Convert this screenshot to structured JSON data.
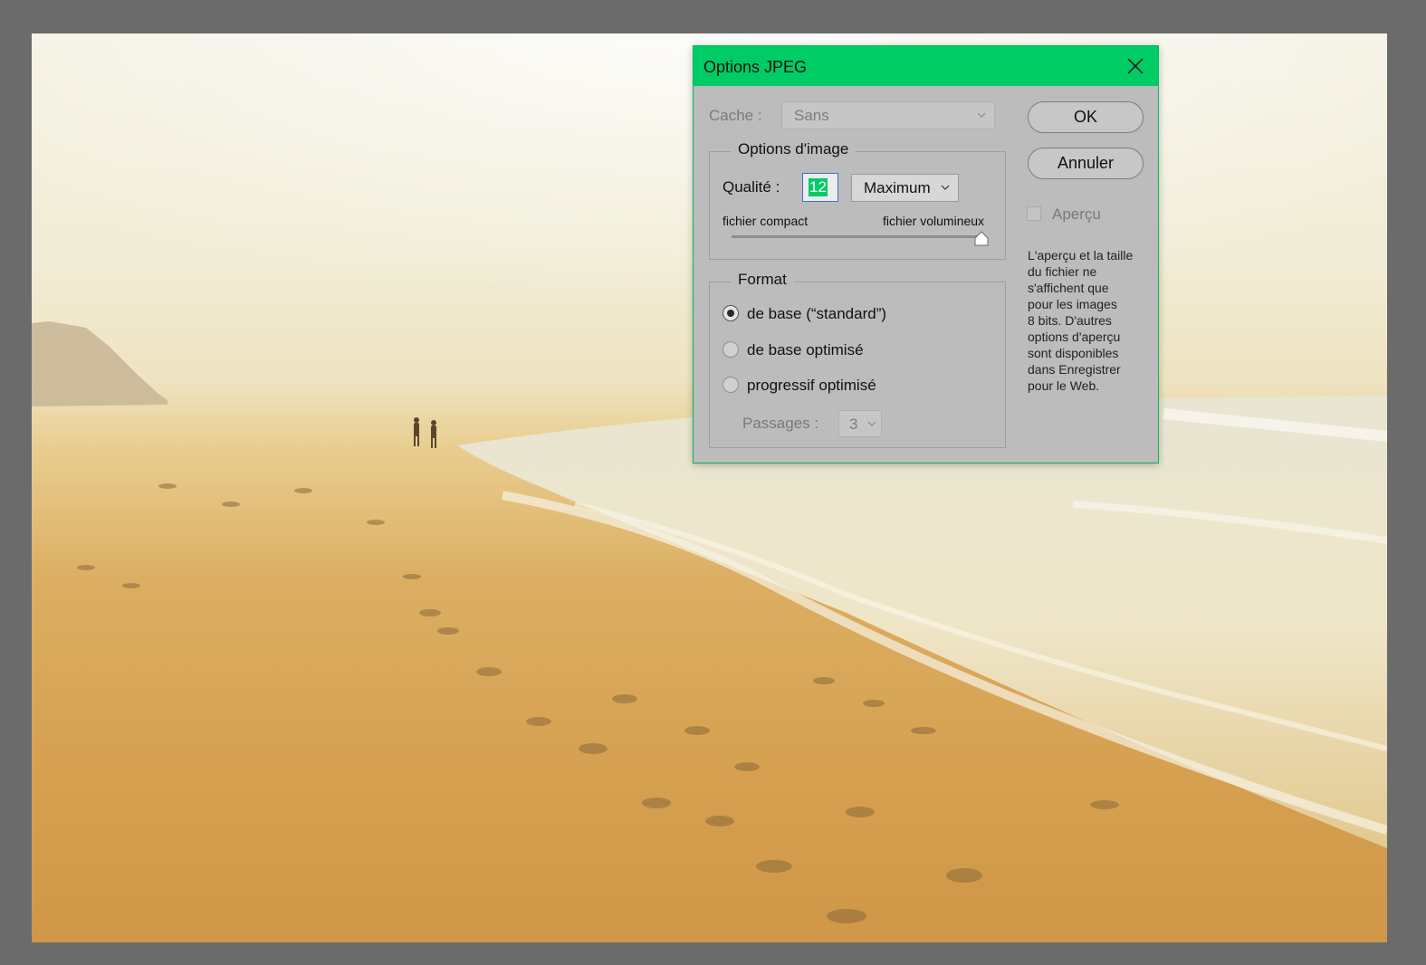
{
  "dialog": {
    "title": "Options JPEG",
    "cache_label": "Cache :",
    "cache_value": "Sans",
    "image_options": {
      "legend": "Options d'image",
      "quality_label": "Qualité :",
      "quality_value": "12",
      "quality_preset": "Maximum",
      "slider_min_label": "fichier compact",
      "slider_max_label": "fichier volumineux",
      "slider_level": 1.0
    },
    "format": {
      "legend": "Format",
      "options": [
        "de base  (“standard”)",
        "de base optimisé",
        "progressif optimisé"
      ],
      "selected_index": 0,
      "passes_label": "Passages :",
      "passes_value": "3"
    },
    "ok_label": "OK",
    "cancel_label": "Annuler",
    "preview_label": "Aperçu",
    "preview_checked": false,
    "info_lines": [
      "L'aperçu et la taille",
      "du fichier ne",
      "s'affichent que",
      "pour les images",
      "8 bits. D'autres",
      "options d'aperçu",
      "sont disponibles",
      "dans Enregistrer",
      "pour le Web."
    ]
  },
  "colors": {
    "titlebar": "#00cc66",
    "dialog_bg": "#bcbcbc",
    "workspace_bg": "#6b6b6b"
  }
}
